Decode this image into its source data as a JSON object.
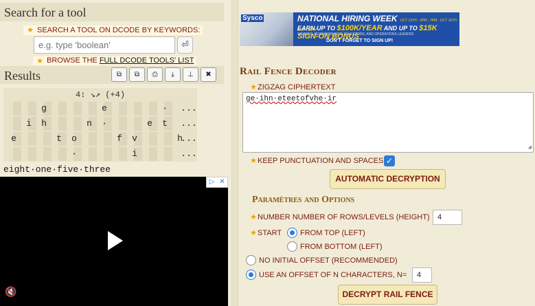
{
  "search": {
    "header": "Search for a tool",
    "prompt": "SEARCH A TOOL ON DCODE BY KEYWORDS:",
    "placeholder": "e.g. type 'boolean'",
    "enter_icon": "⏎",
    "browse_prefix": "BROWSE THE ",
    "browse_link": "FULL DCODE TOOLS' LIST"
  },
  "results": {
    "header": "Results",
    "toolbar": [
      "copy-icon",
      "copy-alt-icon",
      "print-icon",
      "download-icon",
      "pin-icon",
      "close-icon"
    ],
    "grid_header": "4↕ ↘↗ (+4)",
    "grid_rows": [
      [
        "",
        "",
        "g",
        "",
        "",
        "",
        "e",
        "",
        "",
        "",
        "·",
        "",
        "..."
      ],
      [
        "",
        "i",
        "h",
        "",
        "",
        "n",
        "·",
        "",
        "",
        "e",
        "t",
        "",
        "..."
      ],
      [
        "e",
        "",
        "",
        "t",
        "o",
        "",
        "",
        "f",
        "v",
        "",
        "",
        "h",
        "..."
      ],
      [
        "",
        "",
        "",
        "",
        "·",
        "",
        "",
        "",
        "i",
        "",
        "",
        "",
        "..."
      ]
    ],
    "plaintext": "eight·one·five·three"
  },
  "ad": {
    "banner_brand": "Sysco",
    "banner_title": "NATIONAL HIRING WEEK",
    "banner_dates": "OCT 13TH · 3PM - 7PM · OCT 16TH · 8AM - 12PM",
    "banner_offer_1": "EARN UP TO ",
    "banner_offer_amount_1": "$100K/YEAR",
    "banner_offer_2": " AND UP TO ",
    "banner_offer_amount_2": "$15K SIGN-ON BONUS",
    "banner_sub": "SAVINGS, NEIGHBORHOOD SELECTORS, AND OPERATIONS LEADERS",
    "banner_cta": "DON'T FORGET TO SIGN UP!",
    "video_badge_1": "▷",
    "video_badge_2": "✕",
    "mute_icon": "🔇"
  },
  "decoder": {
    "title": "Rail Fence Decoder",
    "zigzag_label": "ZIGZAG CIPHERTEXT",
    "ciphertext": "ge·ihn·eteetofvhe·ir",
    "keep_label": "KEEP PUNCTUATION AND SPACES",
    "keep_checked": true,
    "auto_button": "AUTOMATIC DECRYPTION",
    "params_title": "Paramètres and Options",
    "rows_label": "NUMBER NUMBER OF ROWS/LEVELS (HEIGHT)",
    "rows_value": "4",
    "start_label": "START",
    "from_top": "FROM TOP (LEFT)",
    "from_bottom": "FROM BOTTOM (LEFT)",
    "no_offset": "NO INITIAL OFFSET (RECOMMENDED)",
    "use_offset": "USE AN OFFSET OF N CHARACTERS, N=",
    "offset_value": "4",
    "decrypt_button": "DECRYPT RAIL FENCE"
  }
}
